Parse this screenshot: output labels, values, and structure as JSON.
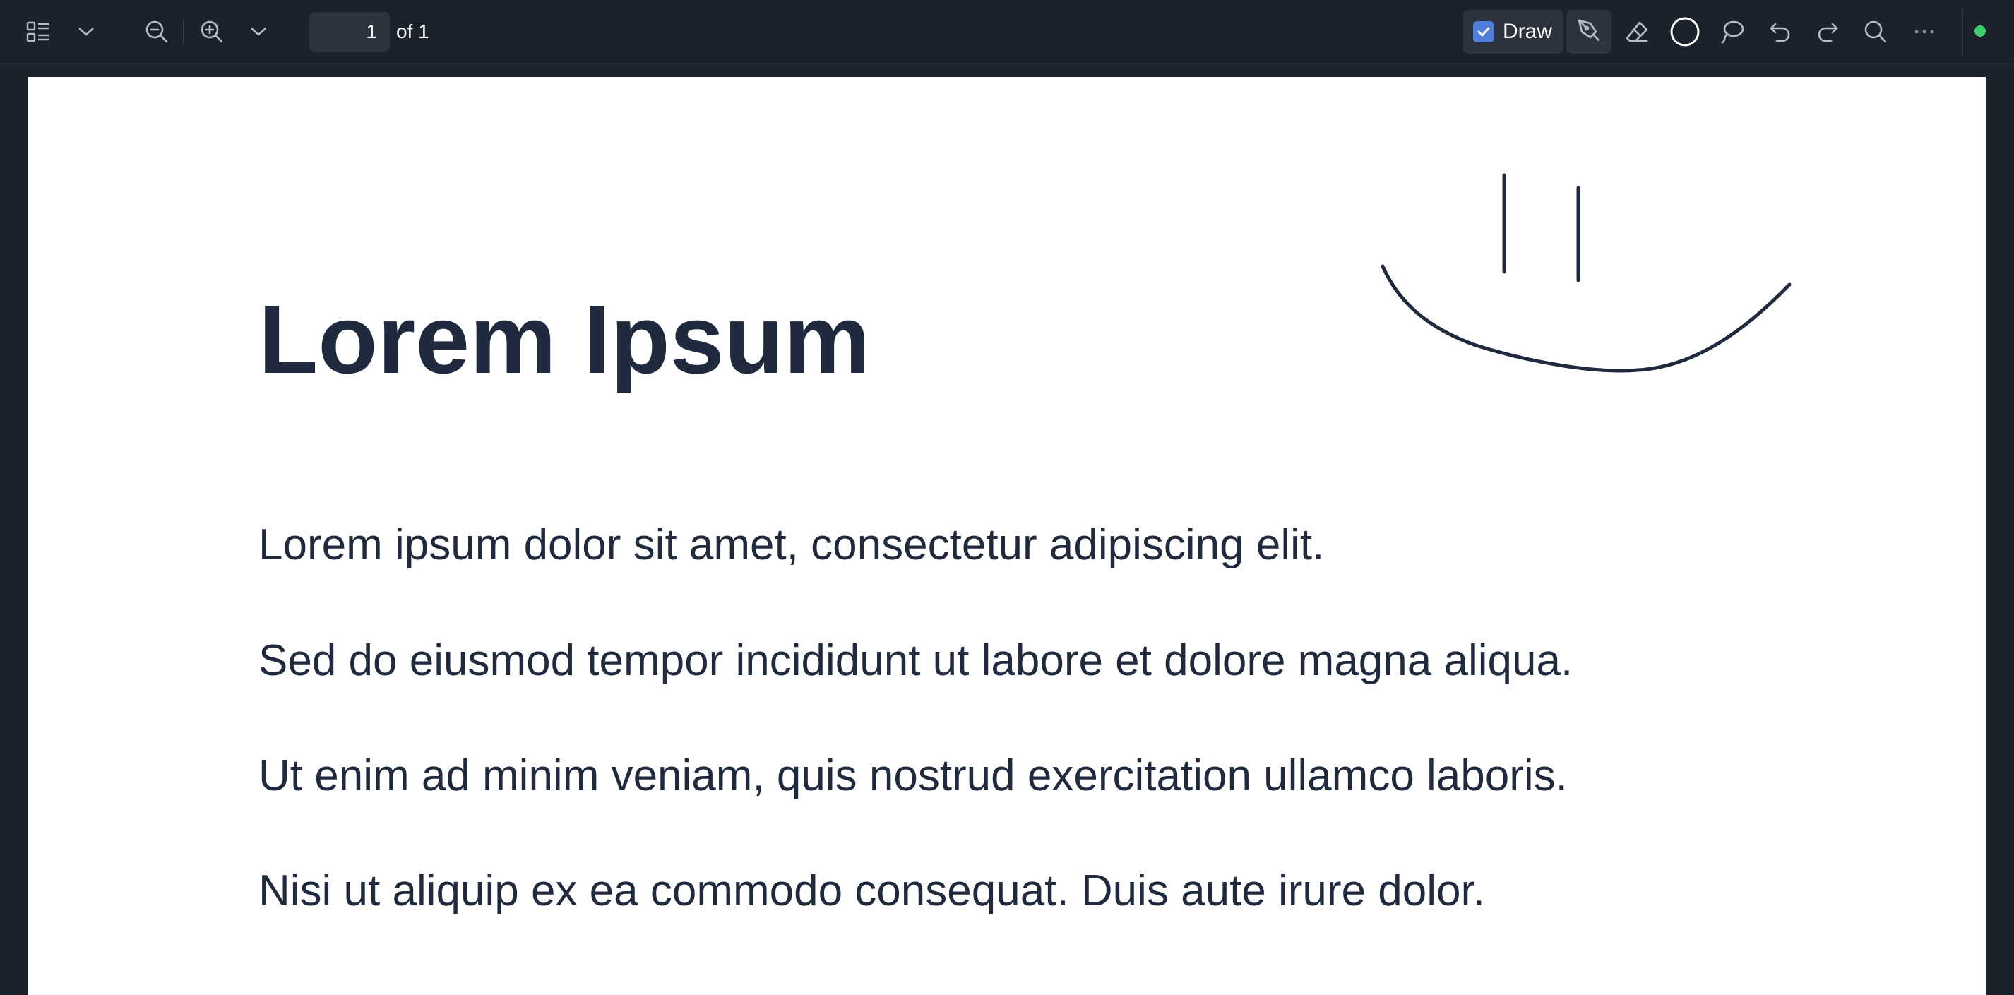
{
  "toolbar": {
    "icons": {
      "thumbnails": "sidebar-thumbnails-icon",
      "view_menu": "chevron-down-icon",
      "zoom_out": "zoom-out-icon",
      "zoom_in": "zoom-in-icon",
      "zoom_menu": "chevron-down-icon",
      "pen": "pen-icon",
      "eraser": "eraser-icon",
      "color": "color-circle-icon",
      "lasso": "lasso-icon",
      "undo": "undo-icon",
      "redo": "redo-icon",
      "search": "search-icon",
      "more": "more-icon"
    },
    "page_number": "1",
    "page_of": "of 1",
    "draw_label": "Draw",
    "draw_checked": true,
    "status": "online"
  },
  "document": {
    "title": "Lorem Ipsum",
    "paragraphs": [
      "Lorem ipsum dolor sit amet, consectetur adipiscing elit.",
      "Sed do eiusmod tempor incididunt ut labore et dolore magna aliqua.",
      "Ut enim ad minim veniam, quis nostrud exercitation ullamco laboris.",
      "Nisi ut aliquip ex ea commodo consequat. Duis aute irure dolor."
    ],
    "annotation": "hand-drawn-smiley"
  },
  "colors": {
    "toolbar_bg": "#1c222c",
    "panel_bg": "#2c333e",
    "text_dark": "#1f2a3f",
    "accent": "#4f7fd8",
    "status_green": "#3ccf6e",
    "ink": "#1f2a3f"
  }
}
